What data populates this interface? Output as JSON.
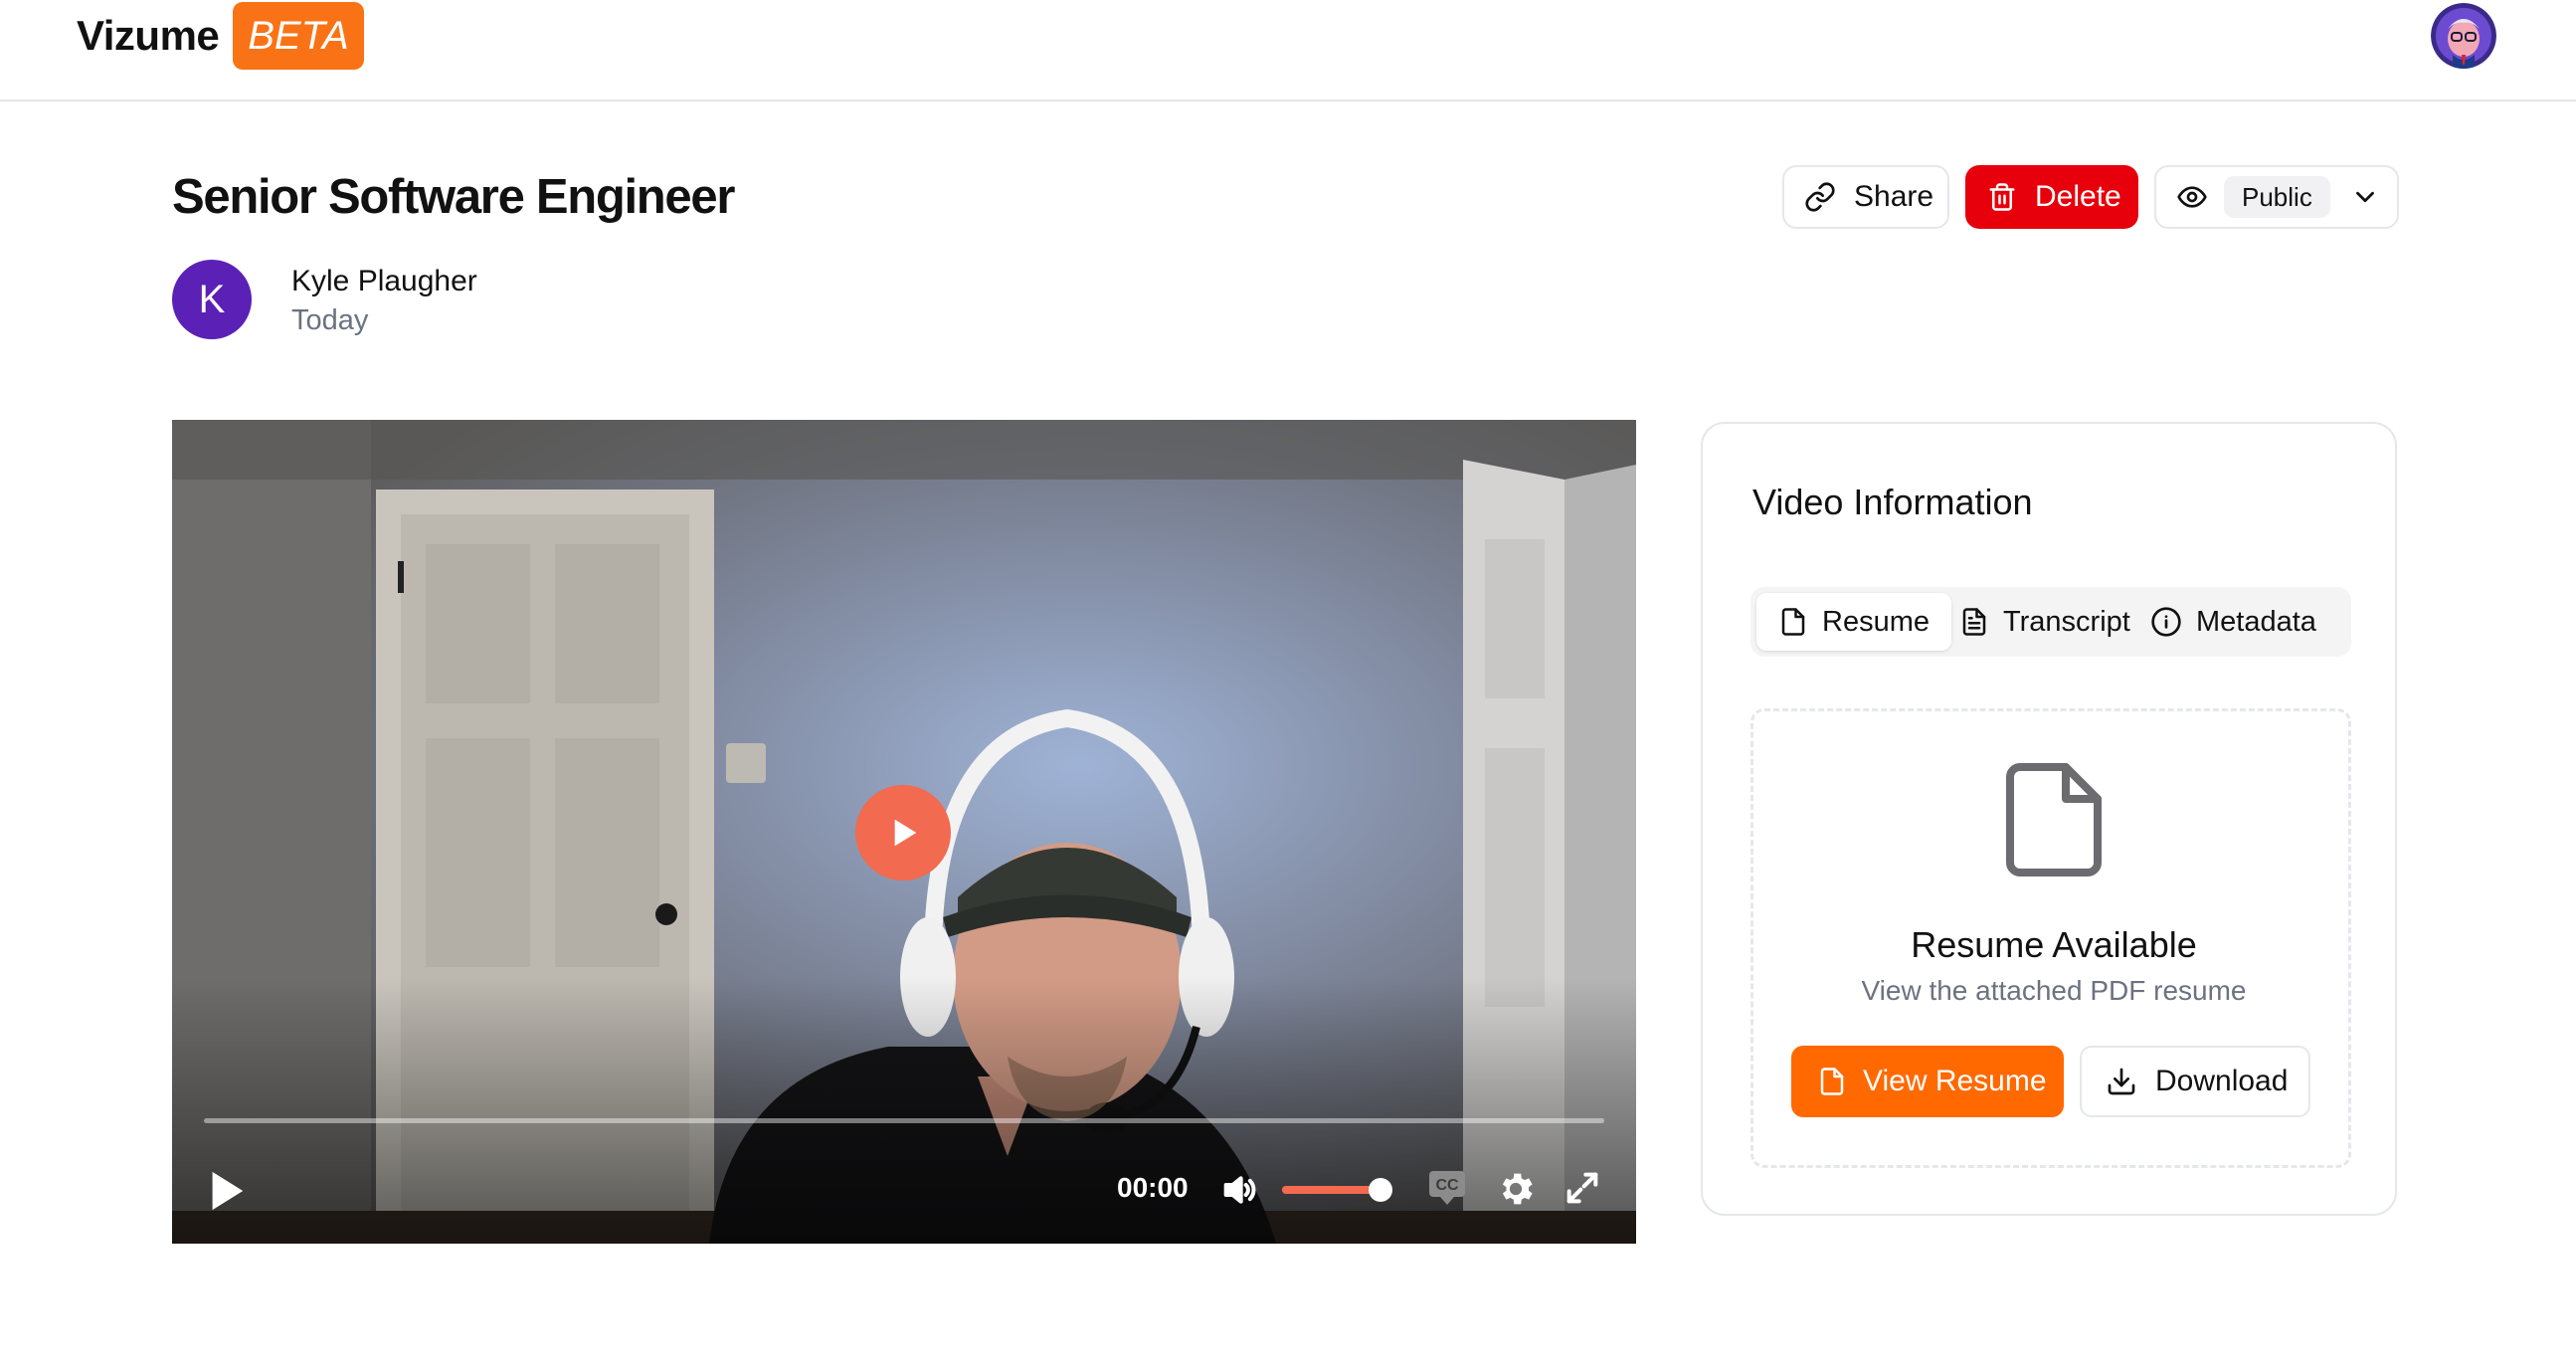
{
  "header": {
    "brand": "Vizume",
    "badge": "BETA"
  },
  "page": {
    "title": "Senior Software Engineer",
    "author": {
      "initial": "K",
      "name": "Kyle Plaugher",
      "date": "Today"
    }
  },
  "actions": {
    "share_label": "Share",
    "delete_label": "Delete",
    "visibility_label": "Public"
  },
  "video": {
    "time": "00:00",
    "progress": 0,
    "volume": 0.92
  },
  "info_card": {
    "title": "Video Information",
    "tabs": [
      {
        "label": "Resume",
        "icon": "file-icon",
        "active": true
      },
      {
        "label": "Transcript",
        "icon": "file-text-icon",
        "active": false
      },
      {
        "label": "Metadata",
        "icon": "info-icon",
        "active": false
      }
    ],
    "resume": {
      "title": "Resume Available",
      "subtitle": "View the attached PDF resume",
      "view_label": "View Resume",
      "download_label": "Download"
    }
  },
  "colors": {
    "brand_orange": "#f97316",
    "delete_red": "#e7000b",
    "author_avatar": "#5b21b6",
    "player_accent": "#f26a4f"
  }
}
